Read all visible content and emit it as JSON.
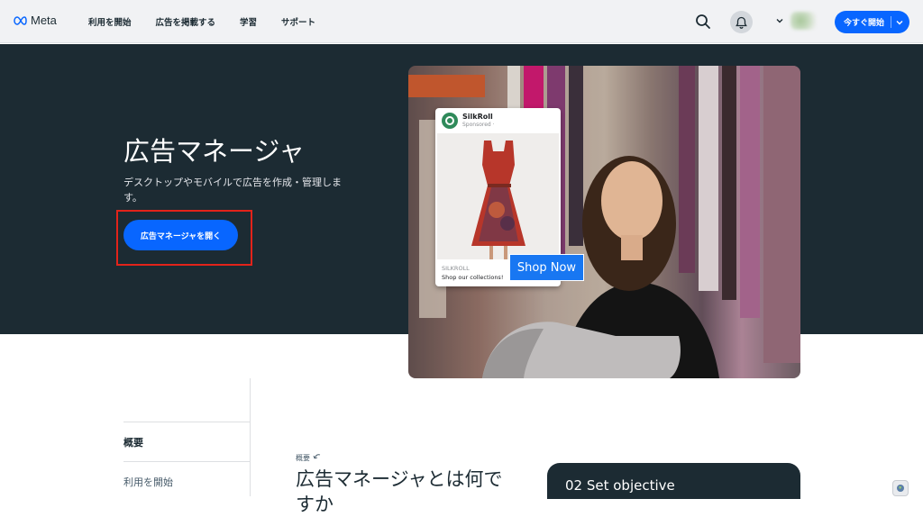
{
  "nav": {
    "brand": "Meta",
    "links": [
      "利用を開始",
      "広告を掲載する",
      "学習",
      "サポート"
    ],
    "cta_label": "今すぐ開始"
  },
  "hero": {
    "title": "広告マネージャ",
    "description": "デスクトップやモバイルで広告を作成・管理します。",
    "button_label": "広告マネージャを開く"
  },
  "ad_preview": {
    "page_name": "SilkRoll",
    "sponsored": "Sponsored · ",
    "brand": "SILKROLL",
    "tagline": "Shop our collections!",
    "cta": "Shop Now"
  },
  "side_nav": {
    "items": [
      "概要",
      "利用を開始"
    ]
  },
  "overview": {
    "label": "概要",
    "title": "広告マネージャとは何ですか"
  },
  "objective_card": {
    "title": "02 Set objective"
  },
  "colors": {
    "accent": "#0866ff",
    "hero_bg": "#1c2b33",
    "highlight": "#e2231a"
  }
}
